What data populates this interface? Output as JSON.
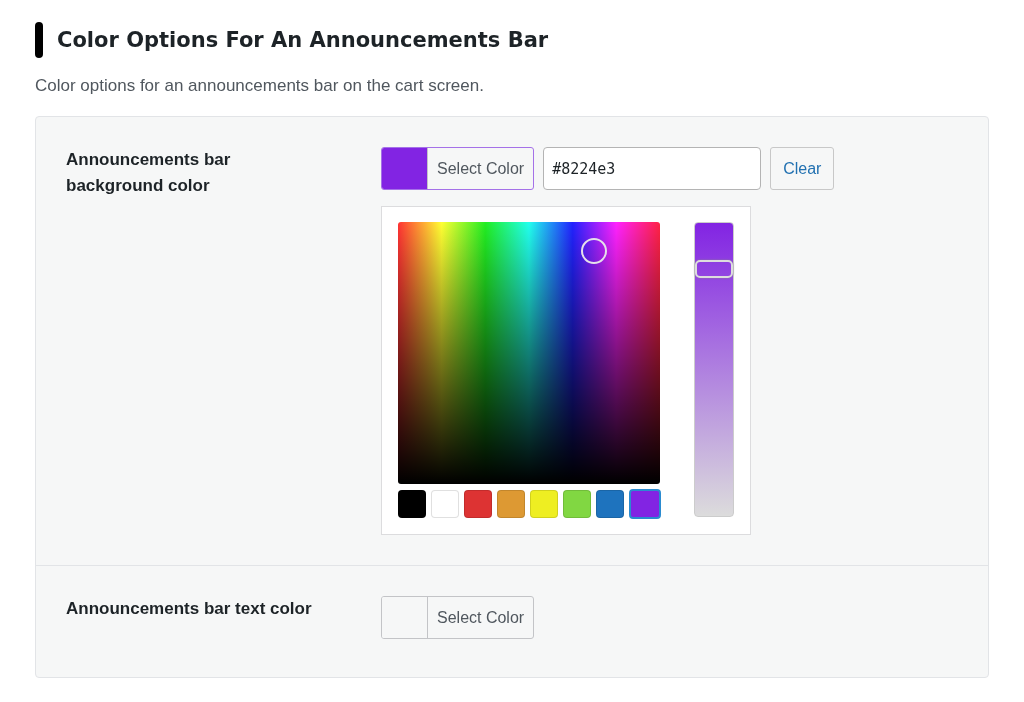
{
  "heading": "Color Options For An Announcements Bar",
  "description": "Color options for an announcements bar on the cart screen.",
  "settings": [
    {
      "label": "Announcements bar background color",
      "button": "Select Color",
      "value": "#8224e3",
      "clear_button": "Clear",
      "picker": {
        "expanded": true,
        "saturation_slider": {
          "level": 0.84
        },
        "palette": [
          {
            "color": "#000000",
            "selected": false
          },
          {
            "color": "#ffffff",
            "selected": false
          },
          {
            "color": "#dd3333",
            "selected": false
          },
          {
            "color": "#dd9933",
            "selected": false
          },
          {
            "color": "#eeee22",
            "selected": false
          },
          {
            "color": "#81d742",
            "selected": false
          },
          {
            "color": "#1e73be",
            "selected": false
          },
          {
            "color": "#8224e3",
            "selected": true
          }
        ]
      }
    },
    {
      "label": "Announcements bar text color",
      "button": "Select Color"
    }
  ]
}
